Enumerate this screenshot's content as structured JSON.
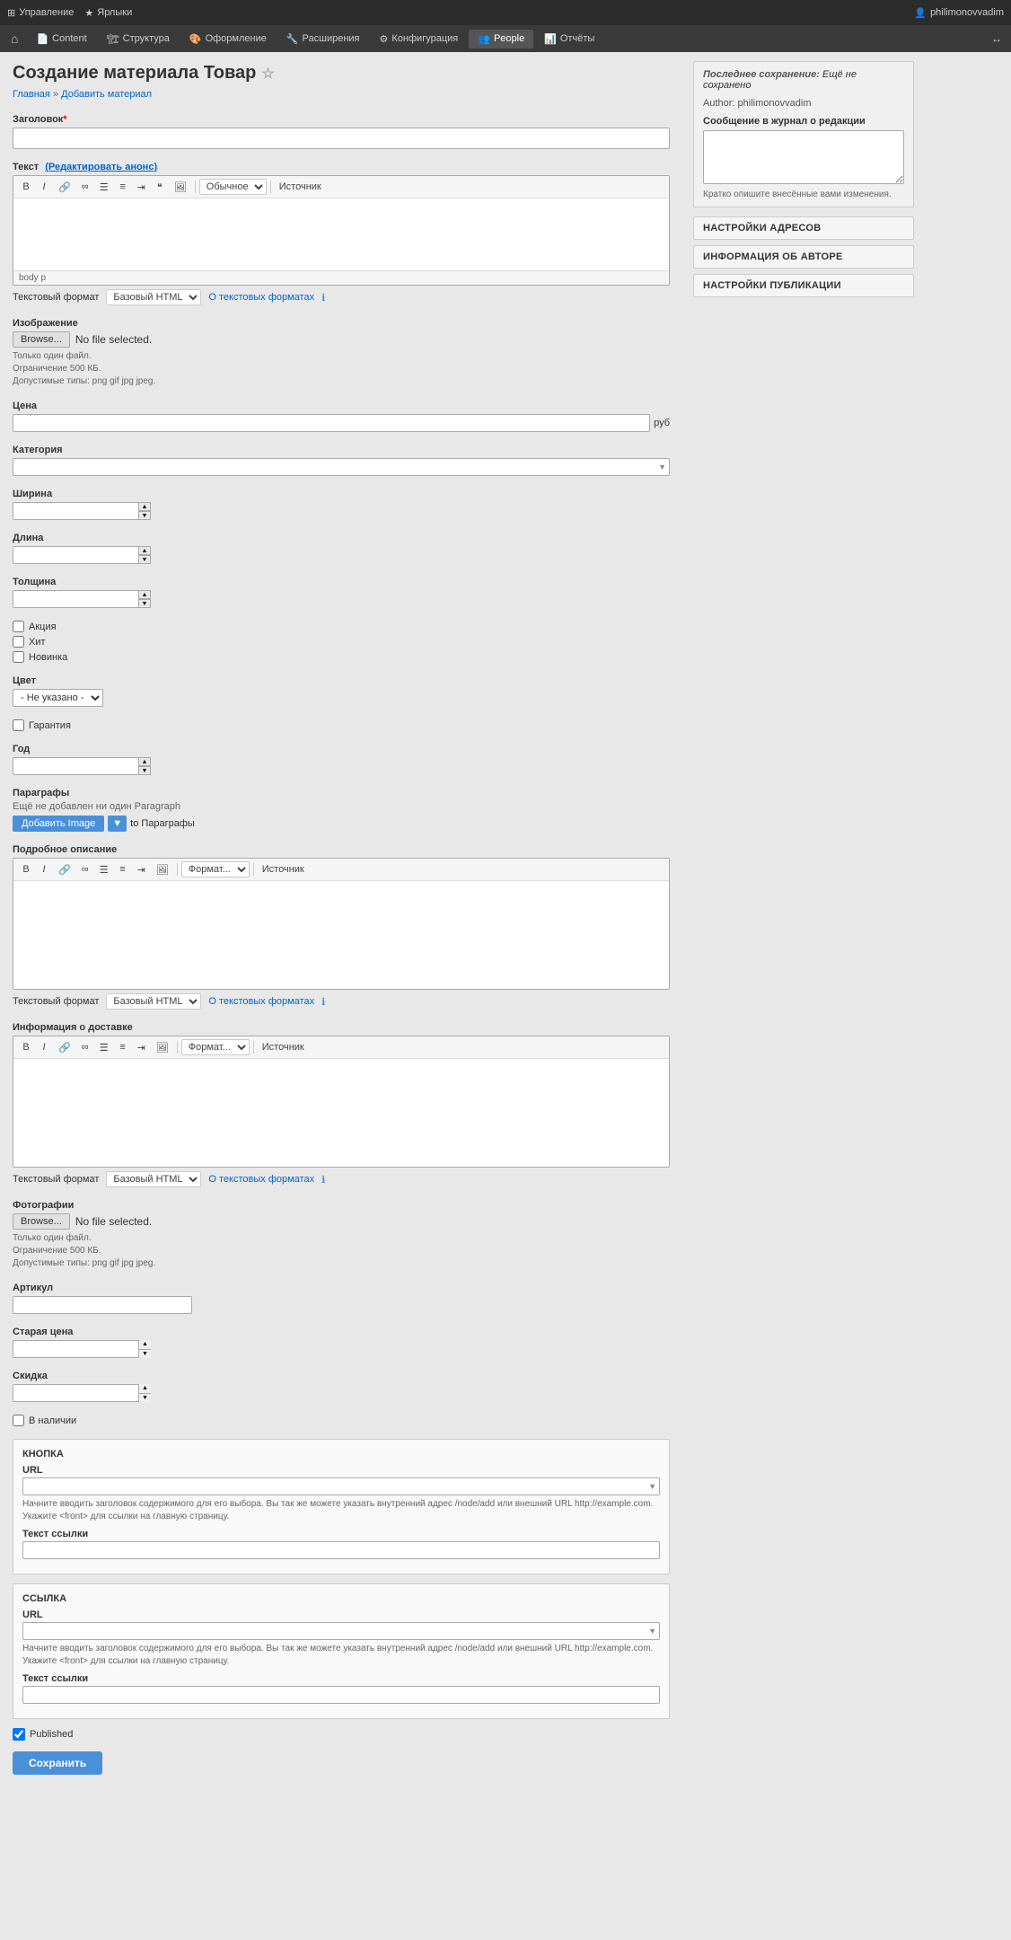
{
  "topbar": {
    "left_items": [
      {
        "label": "Управление",
        "icon": "grid"
      },
      {
        "label": "Ярлыки",
        "icon": "star"
      }
    ],
    "user": "philimonovvadim",
    "expand_icon": "→"
  },
  "navbar": {
    "home_icon": "⌂",
    "items": [
      {
        "label": "Content",
        "icon": "doc",
        "active": false
      },
      {
        "label": "Структура",
        "icon": "structure",
        "active": false
      },
      {
        "label": "Оформление",
        "icon": "paint",
        "active": false
      },
      {
        "label": "Расширения",
        "icon": "extend",
        "active": false
      },
      {
        "label": "Конфигурация",
        "icon": "config",
        "active": false
      },
      {
        "label": "People",
        "icon": "people",
        "active": true
      },
      {
        "label": "Отчёты",
        "icon": "reports",
        "active": false
      }
    ]
  },
  "page": {
    "title": "Создание материала Товар",
    "star_icon": "☆",
    "breadcrumb": {
      "home": "Главная",
      "separator": " » ",
      "current": "Добавить материал"
    }
  },
  "form": {
    "title_label": "Заголовок",
    "title_required": "*",
    "title_placeholder": "",
    "text_label": "Текст",
    "text_edit_link": "(Редактировать анонс)",
    "editor": {
      "buttons": [
        "B",
        "I",
        "≡",
        "∞",
        "☰",
        "⋮",
        "❝",
        "🖼"
      ],
      "format_label": "Обычное",
      "source_label": "Источник",
      "format_select": "Обычное"
    },
    "text_format_label": "Текстовый формат",
    "text_format_value": "Базовый HTML",
    "text_format_link": "О текстовых форматах",
    "editor_status": "body p",
    "image_label": "Изображение",
    "browse_label": "Browse...",
    "no_file": "No file selected.",
    "file_hint_1": "Только один файл.",
    "file_hint_2": "Ограничение 500 КБ.",
    "file_hint_3": "Допустимые типы: png gif jpg jpeg.",
    "price_label": "Цена",
    "price_unit": "руб",
    "category_label": "Категория",
    "width_label": "Ширина",
    "length_label": "Длина",
    "thickness_label": "Толщина",
    "checkboxes": [
      {
        "label": "Акция",
        "checked": false
      },
      {
        "label": "Хит",
        "checked": false
      },
      {
        "label": "Новинка",
        "checked": false
      }
    ],
    "color_label": "Цвет",
    "color_default": "- Не указано -",
    "warranty_checkbox": "Гарантия",
    "year_label": "Год",
    "paragraphs_label": "Параграфы",
    "paragraphs_empty": "Ещё не добавлен ни один Paragraph",
    "add_image_btn": "Добавить Image",
    "to_paragraphs": "to Параграфы",
    "detailed_desc_label": "Подробное описание",
    "delivery_label": "Информация о доставке",
    "photos_label": "Фотографии",
    "article_label": "Артикул",
    "old_price_label": "Старая цена",
    "discount_label": "Скидка",
    "available_checkbox": "В наличии",
    "button_box_title": "КНОПКА",
    "button_url_label": "URL",
    "button_url_hint": "Начните вводить заголовок содержимого для его выбора. Вы так же можете указать внутренний адрес /node/add или внешний URL http://example.com. Укажите <front> для ссылки на главную страницу.",
    "button_link_text_label": "Текст ссылки",
    "link_box_title": "ССЫЛКА",
    "link_url_label": "URL",
    "link_url_hint": "Начните вводить заголовок содержимого для его выбора. Вы так же можете указать внутренний адрес /node/add или внешний URL http://example.com. Укажите <front> для ссылки на главную страницу.",
    "link_link_text_label": "Текст ссылки",
    "published_label": "Published",
    "save_btn": "Сохранить"
  },
  "sidebar": {
    "last_saved_label": "Последнее сохранение:",
    "last_saved_value": "Ещё не сохранено",
    "author_label": "Author:",
    "author_value": "philimonovvadim",
    "journal_label": "Сообщение в журнал о редакции",
    "journal_placeholder": "",
    "journal_hint": "Кратко опишите внесённые вами изменения.",
    "sections": [
      {
        "label": "НАСТРОЙКИ АДРЕСОВ"
      },
      {
        "label": "ИНФОРМАЦИЯ ОБ АВТОРЕ"
      },
      {
        "label": "НАСТРОЙКИ ПУБЛИКАЦИИ"
      }
    ]
  }
}
